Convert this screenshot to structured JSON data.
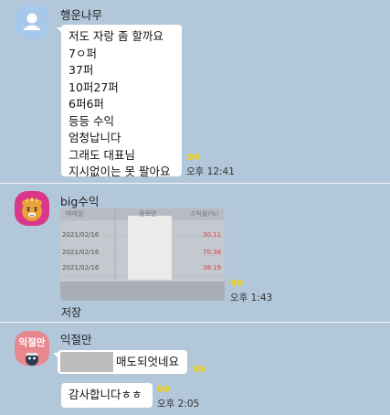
{
  "messages": [
    {
      "sender": "행운나무",
      "lines": [
        "저도 자랑 좀 할까요",
        "7ㅇ퍼",
        "37퍼",
        "10퍼27퍼",
        "6퍼6퍼",
        "등등 수익",
        "엄청납니다",
        "그래도 대표님",
        "지시없이는 못 팔아요"
      ],
      "unread": "99",
      "time": "오후 12:41"
    },
    {
      "sender": "big수익",
      "photo": {
        "header": [
          "매매일",
          "종목명",
          "수익률(%)"
        ],
        "rows": [
          {
            "date": "2021/02/16",
            "rate": "30.11"
          },
          {
            "date": "2021/02/16",
            "rate": "70.38"
          },
          {
            "date": "2021/02/16",
            "rate": "38.19"
          }
        ]
      },
      "save_label": "저장",
      "unread": "99",
      "time": "오후 1:43"
    },
    {
      "sender": "익절만",
      "avatar_text": "익절만",
      "bubble1_text": "매도되엇네요",
      "bubble1_unread": "99",
      "bubble2_text": "감사합니다ㅎㅎ",
      "bubble2_unread": "99",
      "time": "오후 2:05"
    }
  ],
  "colors": {
    "background": "#b2c7da",
    "bubble": "#ffffff",
    "unread": "#f0d000",
    "profit_red": "#e8403a"
  }
}
